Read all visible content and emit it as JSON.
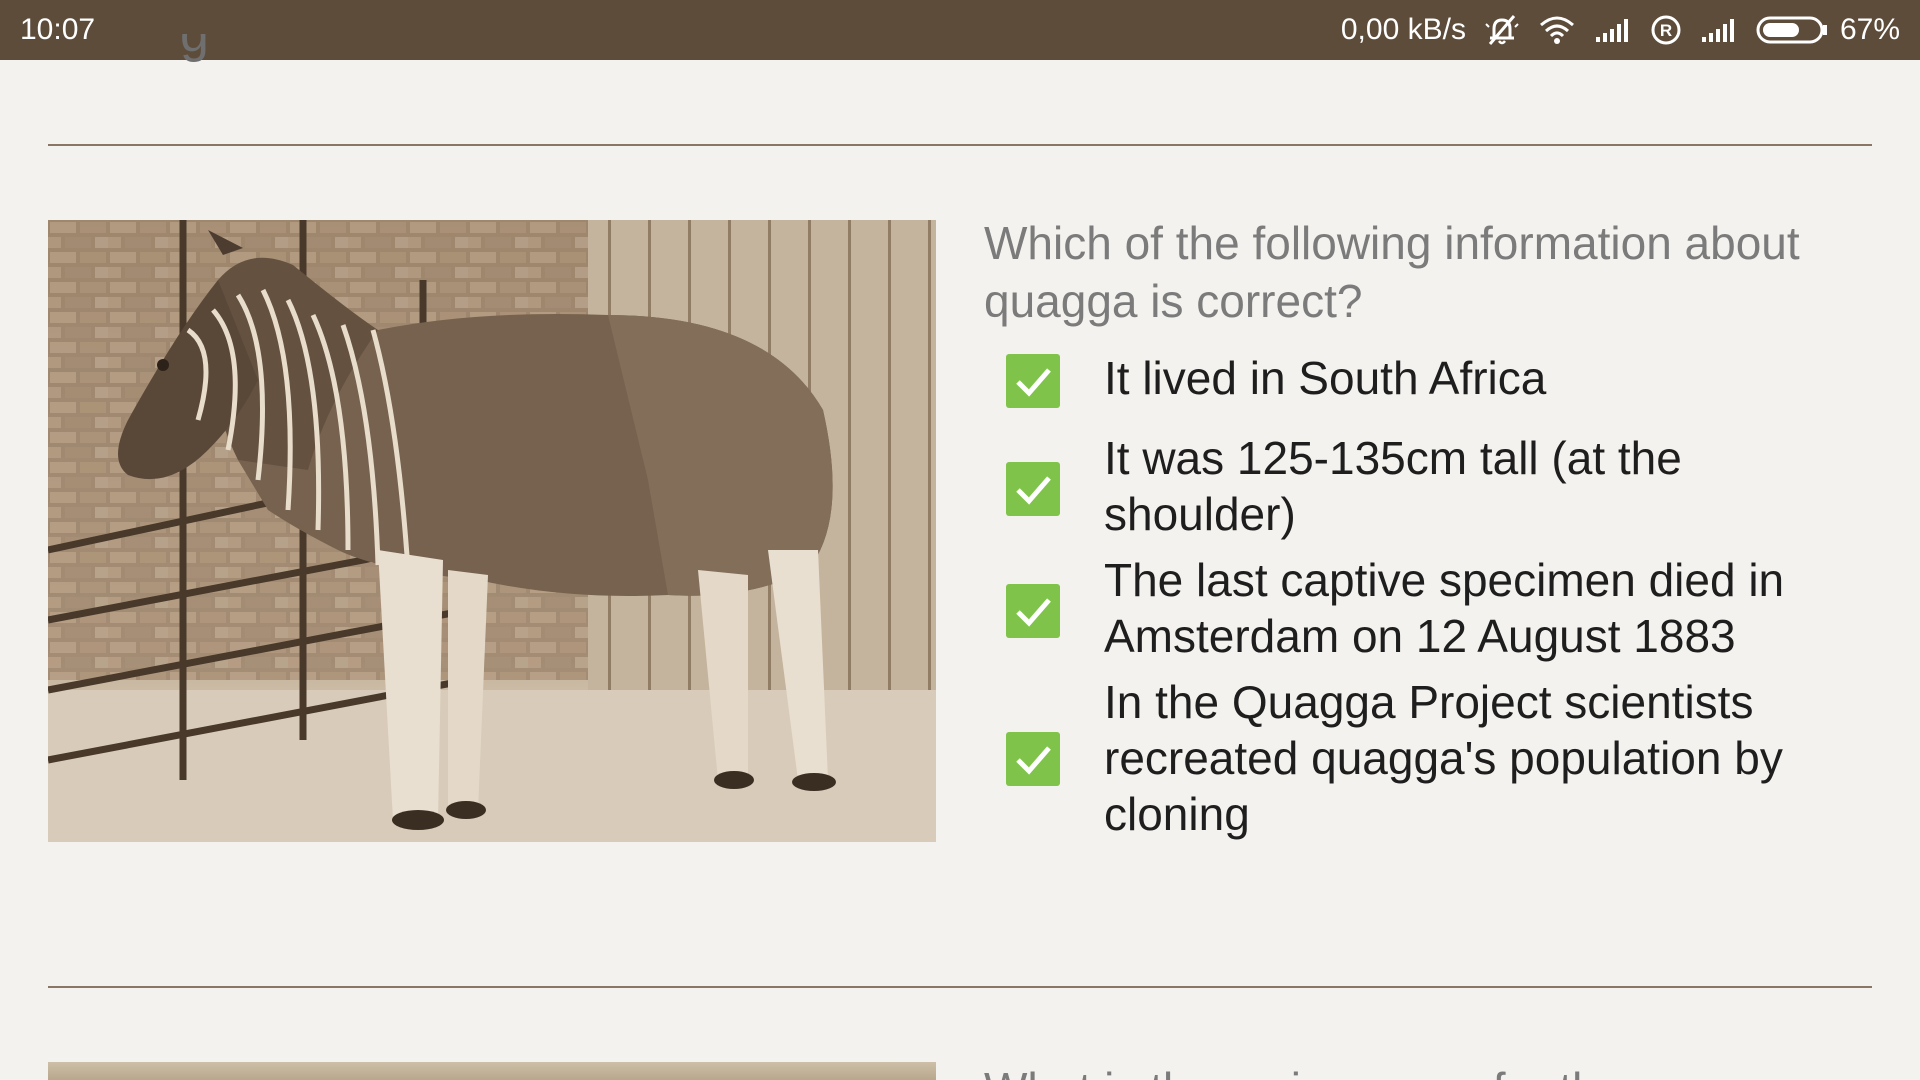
{
  "status_bar": {
    "time": "10:07",
    "network_speed": "0,00 kB/s",
    "battery_percent": "67%",
    "battery_level": 0.67,
    "icons": [
      "alarm-off-icon",
      "wifi-icon",
      "signal-icon",
      "roaming-icon",
      "signal-icon",
      "battery-icon"
    ]
  },
  "previous_card": {
    "partial_text": "g"
  },
  "quiz_card": {
    "image_alt": "quagga photograph",
    "question": "Which of the following information about quagga is correct?",
    "answers": [
      {
        "label": "It lived in South Africa",
        "checked": true
      },
      {
        "label": "It was 125-135cm tall (at the shoulder)",
        "checked": true
      },
      {
        "label": "The last captive specimen died in Amsterdam on 12 August 1883",
        "checked": true
      },
      {
        "label": "In the Quagga Project scientists recreated quagga's population by cloning",
        "checked": true
      }
    ],
    "check_color": "#7fc34a"
  },
  "next_card": {
    "partial_question": "What is the main reason for the"
  },
  "colors": {
    "status_bar_bg": "#5e4c3b",
    "page_bg": "#f4f2ee",
    "divider": "#8a7664",
    "question_text": "#7b7b7b",
    "answer_text": "#1e1e1e"
  }
}
